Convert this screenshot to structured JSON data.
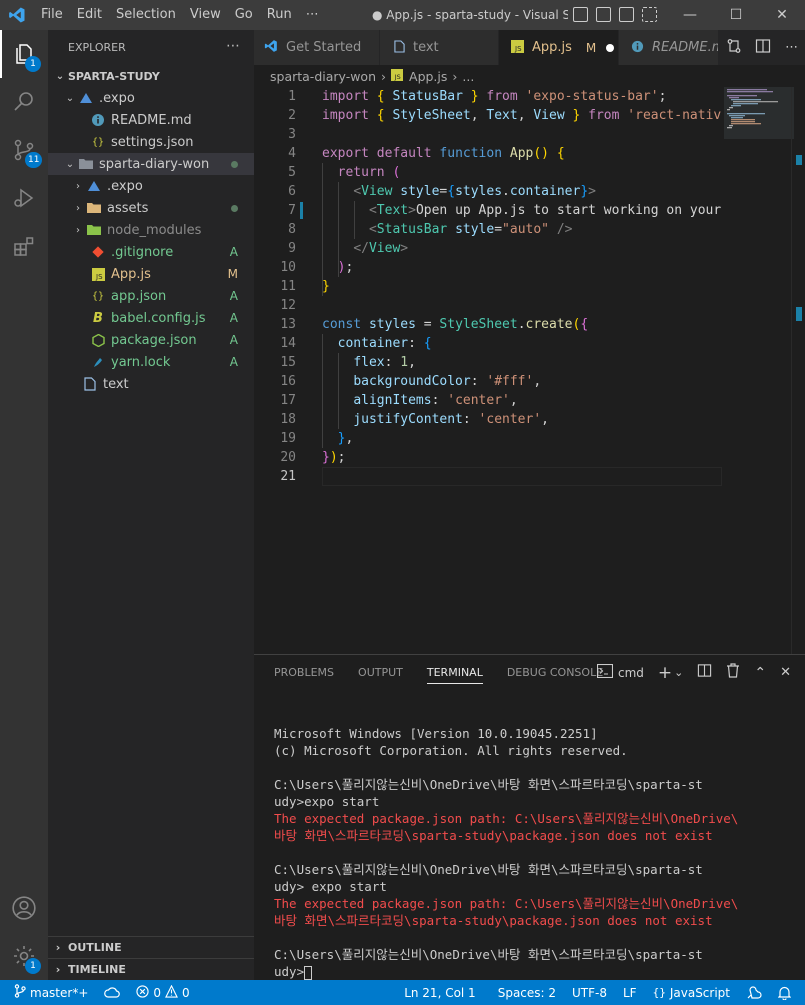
{
  "titlebar": {
    "menu": [
      "File",
      "Edit",
      "Selection",
      "View",
      "Go",
      "Run",
      "⋯"
    ],
    "title": "● App.js - sparta-study - Visual Studio Code"
  },
  "activity": {
    "explorer_badge": "1",
    "scm_badge": "11",
    "settings_badge": "1"
  },
  "sidebar": {
    "header": "EXPLORER",
    "root": "SPARTA-STUDY",
    "items": [
      {
        "label": ".expo",
        "status": ""
      },
      {
        "label": "README.md",
        "status": ""
      },
      {
        "label": "settings.json",
        "status": ""
      },
      {
        "label": "sparta-diary-won",
        "status": ""
      },
      {
        "label": ".expo",
        "status": ""
      },
      {
        "label": "assets",
        "status": ""
      },
      {
        "label": "node_modules",
        "status": ""
      },
      {
        "label": ".gitignore",
        "status": "A"
      },
      {
        "label": "App.js",
        "status": "M"
      },
      {
        "label": "app.json",
        "status": "A"
      },
      {
        "label": "babel.config.js",
        "status": "A"
      },
      {
        "label": "package.json",
        "status": "A"
      },
      {
        "label": "yarn.lock",
        "status": "A"
      },
      {
        "label": "text",
        "status": ""
      }
    ],
    "outline": "OUTLINE",
    "timeline": "TIMELINE"
  },
  "tabs": [
    {
      "label": "Get Started",
      "status": ""
    },
    {
      "label": "text",
      "status": ""
    },
    {
      "label": "App.js",
      "status": "M"
    },
    {
      "label": "README.md",
      "status": ""
    }
  ],
  "breadcrumb": {
    "folder": "sparta-diary-won",
    "file": "App.js",
    "more": "..."
  },
  "editor": {
    "line_numbers": [
      "1",
      "2",
      "3",
      "4",
      "5",
      "6",
      "7",
      "8",
      "9",
      "10",
      "11",
      "12",
      "13",
      "14",
      "15",
      "16",
      "17",
      "18",
      "19",
      "20",
      "21"
    ],
    "code": {
      "import": "import",
      "from": "from",
      "StatusBar": "StatusBar",
      "StyleSheet": "StyleSheet",
      "Text": "Text",
      "View": "View",
      "s_expo": "'expo-status-bar'",
      "s_rn": "'react-native'",
      "export": "export",
      "default": "default",
      "function": "function",
      "App": "App",
      "return": "return",
      "style": "style",
      "styles": "styles",
      "container": "container",
      "text7": "Open up App.js to start working on your app!",
      "s_auto": "\"auto\"",
      "const": "const",
      "create": "create",
      "flex": "flex",
      "n1": "1",
      "backgroundColor": "backgroundColor",
      "s_fff": "'#fff'",
      "alignItems": "alignItems",
      "s_center": "'center'",
      "justifyContent": "justifyContent"
    }
  },
  "panel": {
    "tabs": [
      "PROBLEMS",
      "OUTPUT",
      "TERMINAL",
      "DEBUG CONSOLE"
    ],
    "shell": "cmd",
    "terminal": [
      {
        "text": "Microsoft Windows [Version 10.0.19045.2251]",
        "err": false
      },
      {
        "text": "(c) Microsoft Corporation. All rights reserved.",
        "err": false
      },
      {
        "text": "",
        "err": false
      },
      {
        "text": "C:\\Users\\풀리지않는신비\\OneDrive\\바탕 화면\\스파르타코딩\\sparta-st",
        "err": false
      },
      {
        "text": "udy>expo start",
        "err": false
      },
      {
        "text": "The expected package.json path: C:\\Users\\풀리지않는신비\\OneDrive\\",
        "err": true
      },
      {
        "text": "바탕 화면\\스파르타코딩\\sparta-study\\package.json does not exist",
        "err": true
      },
      {
        "text": "",
        "err": false
      },
      {
        "text": "C:\\Users\\풀리지않는신비\\OneDrive\\바탕 화면\\스파르타코딩\\sparta-st",
        "err": false
      },
      {
        "text": "udy> expo start",
        "err": false
      },
      {
        "text": "The expected package.json path: C:\\Users\\풀리지않는신비\\OneDrive\\",
        "err": true
      },
      {
        "text": "바탕 화면\\스파르타코딩\\sparta-study\\package.json does not exist",
        "err": true
      },
      {
        "text": "",
        "err": false
      },
      {
        "text": "C:\\Users\\풀리지않는신비\\OneDrive\\바탕 화면\\스파르타코딩\\sparta-st",
        "err": false
      },
      {
        "text": "udy>",
        "err": false
      }
    ]
  },
  "statusbar": {
    "branch": "master*+",
    "errors": "0",
    "warnings": "0",
    "position": "Ln 21, Col 1",
    "spaces": "Spaces: 2",
    "encoding": "UTF-8",
    "eol": "LF",
    "language": "JavaScript"
  },
  "colors": {
    "accent": "#007acc",
    "added": "#73c991",
    "modified": "#e2c08d",
    "error": "#f14c4c"
  }
}
